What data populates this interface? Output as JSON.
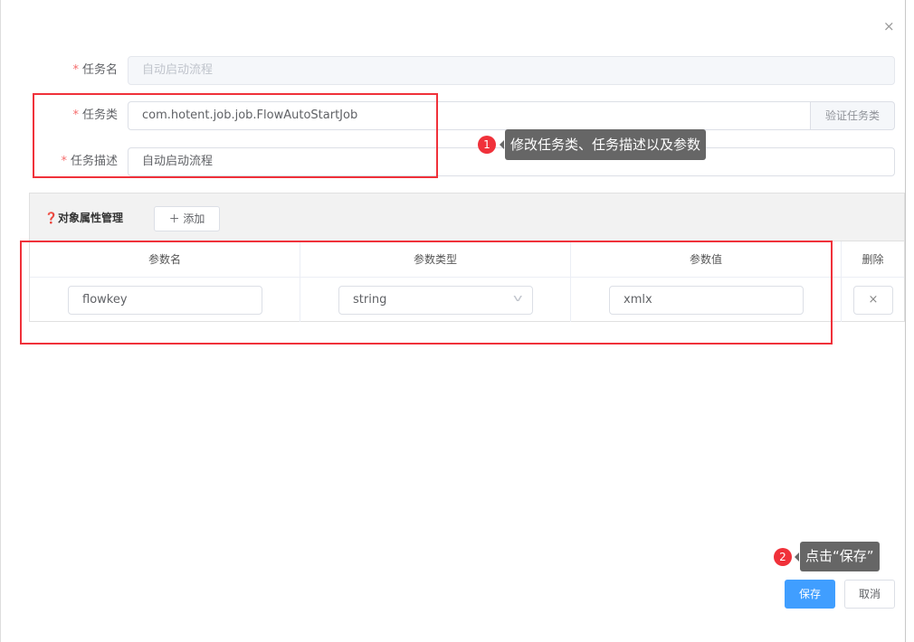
{
  "dialog": {
    "close_icon": "×"
  },
  "form": {
    "task_name": {
      "label": "任务名",
      "value": "自动启动流程"
    },
    "task_class": {
      "label": "任务类",
      "value": "com.hotent.job.job.FlowAutoStartJob",
      "verify_label": "验证任务类"
    },
    "task_desc": {
      "label": "任务描述",
      "value": "自动启动流程"
    },
    "required_mark": "*"
  },
  "params": {
    "title": "❓对象属性管理",
    "add_label": "＋ 添加",
    "columns": [
      "参数名",
      "参数类型",
      "参数值",
      "删除"
    ],
    "rows": [
      {
        "name": "flowkey",
        "type": "string",
        "value": "xmlx",
        "delete": "×"
      }
    ]
  },
  "annotations": [
    {
      "number": "1",
      "text": "修改任务类、任务描述以及参数"
    },
    {
      "number": "2",
      "text": "点击“保存”"
    }
  ],
  "footer": {
    "save_label": "保存",
    "cancel_label": "取消"
  },
  "colors": {
    "primary": "#409eff",
    "annotation_red": "#f0313a",
    "tooltip": "#666666"
  }
}
